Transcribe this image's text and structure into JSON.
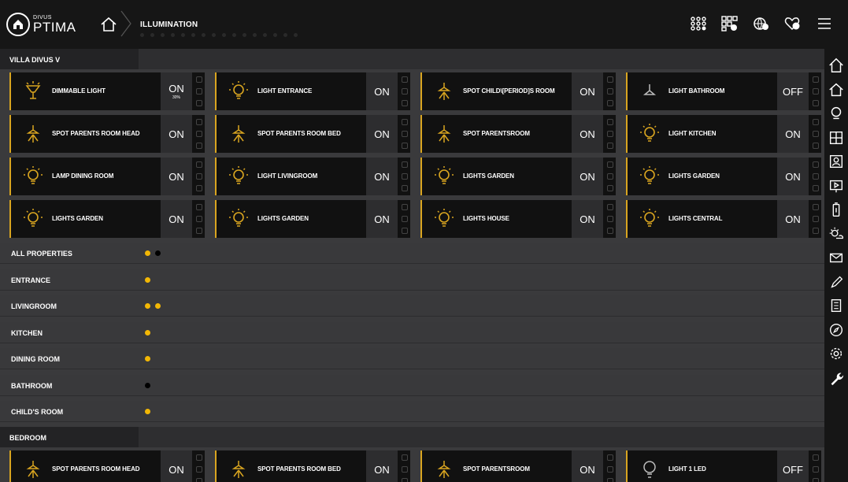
{
  "header": {
    "logo_small": "DIVUS",
    "logo_big": "PTIMA",
    "breadcrumb": "ILLUMINATION"
  },
  "sections": [
    {
      "label": "VILLA DIVUS V",
      "tiles": [
        {
          "name": "DIMMABLE LIGHT",
          "state": "ON",
          "percent": "30%",
          "icon": "dimmable-lamp-icon"
        },
        {
          "name": "LIGHT ENTRANCE",
          "state": "ON",
          "icon": "bulb-icon"
        },
        {
          "name": "SPOT CHILD\\[PERIOD]S ROOM",
          "state": "ON",
          "icon": "spotlight-icon"
        },
        {
          "name": "LIGHT BATHROOM",
          "state": "OFF",
          "icon": "spotlight-off-icon"
        },
        {
          "name": "SPOT PARENTS ROOM HEAD",
          "state": "ON",
          "icon": "spotlight-icon"
        },
        {
          "name": "SPOT PARENTS ROOM BED",
          "state": "ON",
          "icon": "spotlight-icon"
        },
        {
          "name": "SPOT PARENTSROOM",
          "state": "ON",
          "icon": "spotlight-icon"
        },
        {
          "name": "LIGHT KITCHEN",
          "state": "ON",
          "icon": "bulb-icon"
        },
        {
          "name": "LAMP DINING ROOM",
          "state": "ON",
          "icon": "bulb-icon"
        },
        {
          "name": "LIGHT LIVINGROOM",
          "state": "ON",
          "icon": "bulb-icon"
        },
        {
          "name": "LIGHTS GARDEN",
          "state": "ON",
          "icon": "bulb-icon"
        },
        {
          "name": "LIGHTS GARDEN",
          "state": "ON",
          "icon": "bulb-icon"
        },
        {
          "name": "LIGHTS GARDEN",
          "state": "ON",
          "icon": "bulb-icon"
        },
        {
          "name": "LIGHTS GARDEN",
          "state": "ON",
          "icon": "bulb-icon"
        },
        {
          "name": "LIGHTS HOUSE",
          "state": "ON",
          "icon": "bulb-icon"
        },
        {
          "name": "LIGHTS CENTRAL",
          "state": "ON",
          "icon": "bulb-icon"
        }
      ]
    },
    {
      "label": "BEDROOM",
      "tiles": [
        {
          "name": "SPOT PARENTS ROOM HEAD",
          "state": "ON",
          "icon": "spotlight-icon"
        },
        {
          "name": "SPOT PARENTS ROOM BED",
          "state": "ON",
          "icon": "spotlight-icon"
        },
        {
          "name": "SPOT PARENTSROOM",
          "state": "ON",
          "icon": "spotlight-icon"
        },
        {
          "name": "LIGHT 1 LED",
          "state": "OFF",
          "icon": "bulb-off-icon"
        }
      ]
    }
  ],
  "rooms": [
    {
      "label": "ALL PROPERTIES",
      "dots": [
        "#f2b705",
        "#000000"
      ]
    },
    {
      "label": "ENTRANCE",
      "dots": [
        "#f2b705"
      ]
    },
    {
      "label": "LIVINGROOM",
      "dots": [
        "#f2b705",
        "#f2b705"
      ]
    },
    {
      "label": "KITCHEN",
      "dots": [
        "#f2b705"
      ]
    },
    {
      "label": "DINING ROOM",
      "dots": [
        "#f2b705"
      ]
    },
    {
      "label": "BATHROOM",
      "dots": [
        "#000000"
      ]
    },
    {
      "label": "CHILD'S ROOM",
      "dots": [
        "#f2b705"
      ]
    }
  ],
  "top_icons": [
    "scenes-icon",
    "grid-info-icon",
    "globe-info-icon",
    "favorites-info-icon",
    "menu-icon"
  ],
  "sidebar_icons": [
    "home-icon",
    "home-outline-icon",
    "search-icon",
    "floorplan-icon",
    "user-card-icon",
    "presentation-icon",
    "battery-icon",
    "weather-icon",
    "mail-icon",
    "pencil-icon",
    "list-icon",
    "compass-icon",
    "settings-icon",
    "wrench-icon"
  ],
  "colors": {
    "accent": "#d9a520",
    "active_dot": "#f2b705"
  }
}
